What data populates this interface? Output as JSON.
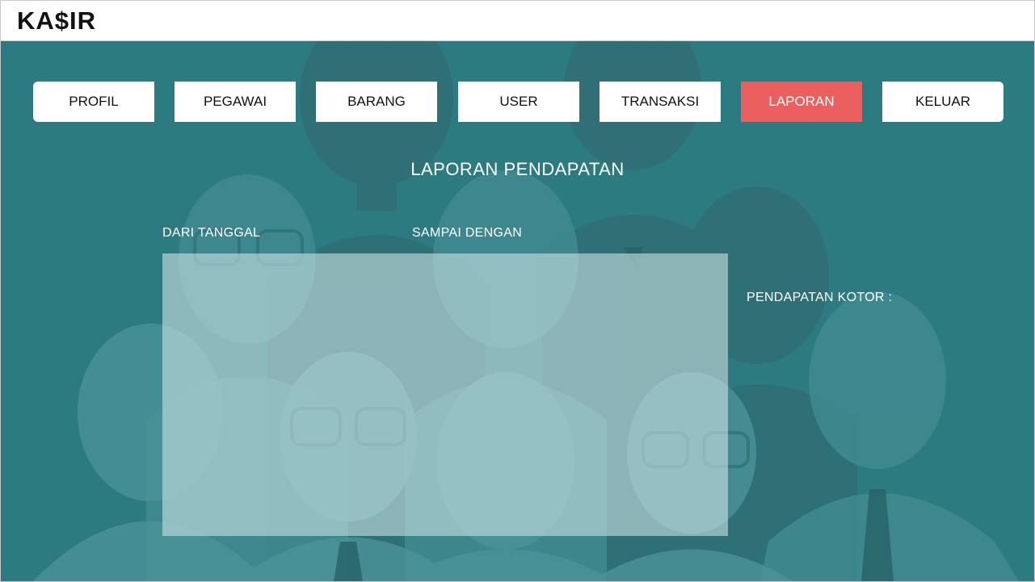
{
  "app": {
    "logo": "KA$IR"
  },
  "nav": {
    "items": [
      {
        "label": "PROFIL",
        "active": false
      },
      {
        "label": "PEGAWAI",
        "active": false
      },
      {
        "label": "BARANG",
        "active": false
      },
      {
        "label": "USER",
        "active": false
      },
      {
        "label": "TRANSAKSI",
        "active": false
      },
      {
        "label": "LAPORAN",
        "active": true
      },
      {
        "label": "KELUAR",
        "active": false
      }
    ]
  },
  "report": {
    "title": "LAPORAN PENDAPATAN",
    "from_label": "DARI TANGGAL",
    "to_label": "SAMPAI DENGAN",
    "gross_label": "PENDAPATAN KOTOR :"
  },
  "colors": {
    "background": "#2b7b80",
    "active_tab": "#ec5f5f",
    "panel": "#c6dee0"
  }
}
